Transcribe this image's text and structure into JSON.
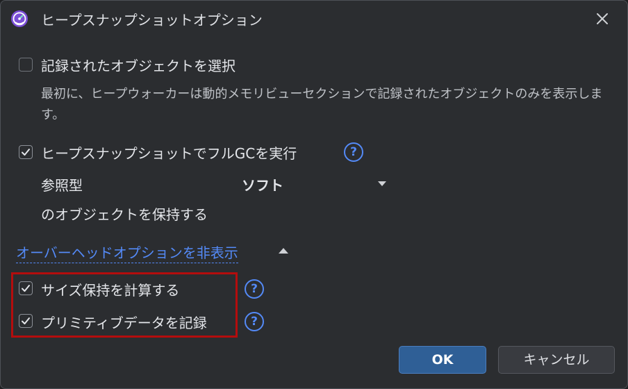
{
  "window": {
    "title": "ヒープスナップショットオプション",
    "app_icon": "profiler-gauge-icon",
    "close_icon": "close-icon"
  },
  "options": {
    "select_objects": {
      "label": "記録されたオブジェクトを選択",
      "checked": false,
      "description": "最初に、ヒープウォーカーは動的メモリビューセクションで記録されたオブジェクトのみを表示します。"
    },
    "full_gc": {
      "label": "ヒープスナップショットでフルGCを実行",
      "checked": true,
      "help": "?"
    },
    "reference_type": {
      "prefix": "参照型",
      "value": "ソフト",
      "suffix": "のオブジェクトを保持する"
    }
  },
  "overhead_toggle": {
    "label": "オーバーヘッドオプションを非表示",
    "icon": "triangle-up-icon"
  },
  "overhead_options": {
    "calc_retained": {
      "label": "サイズ保持を計算する",
      "checked": true,
      "help": "?"
    },
    "record_primitives": {
      "label": "プリミティブデータを記録",
      "checked": true,
      "help": "?"
    }
  },
  "buttons": {
    "ok": "OK",
    "cancel": "キャンセル"
  },
  "colors": {
    "background": "#2b2d30",
    "link": "#548af7",
    "highlight_border": "#b40d0d",
    "primary_button": "#2f5f96"
  }
}
